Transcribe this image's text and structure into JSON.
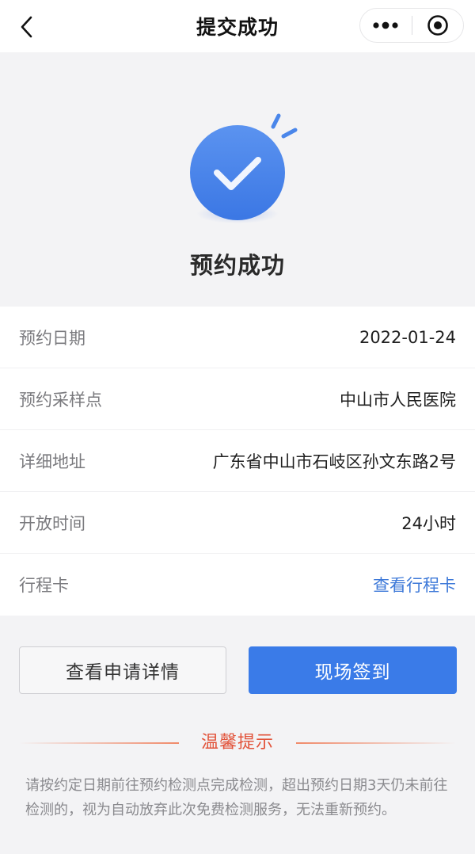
{
  "navbar": {
    "title": "提交成功",
    "back_icon": "chevron-left-icon",
    "more_icon": "more-dots-icon",
    "close_icon": "target-circle-icon"
  },
  "hero": {
    "title": "预约成功",
    "icon": "check-circle-icon",
    "icon_color": "#4a86ea"
  },
  "info": {
    "rows": [
      {
        "label": "预约日期",
        "value": "2022-01-24"
      },
      {
        "label": "预约采样点",
        "value": "中山市人民医院"
      },
      {
        "label": "详细地址",
        "value": "广东省中山市石岐区孙文东路2号"
      },
      {
        "label": "开放时间",
        "value": "24小时"
      },
      {
        "label": "行程卡",
        "value": "查看行程卡"
      }
    ]
  },
  "actions": {
    "details_label": "查看申请详情",
    "checkin_label": "现场签到",
    "primary_color": "#3a7be8"
  },
  "tips": {
    "title": "温馨提示",
    "text": "请按约定日期前往预约检测点完成检测，超出预约日期3天仍未前往检测的，视为自动放弃此次免费检测服务，无法重新预约。",
    "accent_color": "#e2533a"
  }
}
